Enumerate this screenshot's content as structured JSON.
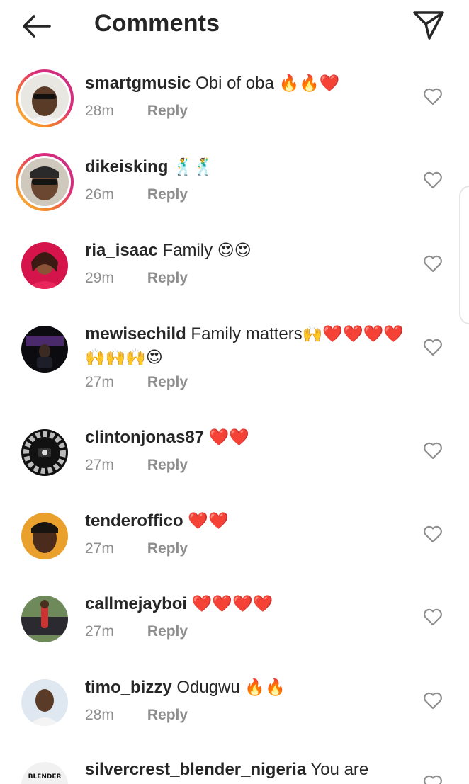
{
  "header": {
    "title": "Comments"
  },
  "actions": {
    "reply_label": "Reply"
  },
  "comments": [
    {
      "username": "smartgmusic",
      "text": "Obi of oba",
      "emoji": "🔥🔥❤️",
      "time": "28m",
      "story_ring": true
    },
    {
      "username": "dikeisking",
      "text": "",
      "emoji": "🕺🕺",
      "time": "26m",
      "story_ring": true
    },
    {
      "username": "ria_isaac",
      "text": "Family",
      "emoji": "😍😍",
      "time": "29m",
      "story_ring": false
    },
    {
      "username": "mewisechild",
      "text": "Family  matters",
      "emoji": "🙌❤️❤️❤️❤️🙌🙌🙌😍",
      "time": "27m",
      "story_ring": false
    },
    {
      "username": "clintonjonas87",
      "text": "",
      "emoji": "❤️❤️",
      "time": "27m",
      "story_ring": false
    },
    {
      "username": "tenderoffico",
      "text": "",
      "emoji": "❤️❤️",
      "time": "27m",
      "story_ring": false
    },
    {
      "username": "callmejayboi",
      "text": "",
      "emoji": "❤️❤️❤️❤️",
      "time": "27m",
      "story_ring": false
    },
    {
      "username": "timo_bizzy",
      "text": "Odugwu",
      "emoji": "🔥🔥",
      "time": "28m",
      "story_ring": false
    },
    {
      "username": "silvercrest_blender_nigeria",
      "text": "You are",
      "emoji": "",
      "time": "",
      "story_ring": false,
      "avatar_text": "BLENDER"
    }
  ],
  "colors": {
    "text": "#262626",
    "meta": "#8e8e8e",
    "story_ring_start": "#f6c243",
    "story_ring_end": "#c13584"
  },
  "icons": {
    "back": "arrow-left-icon",
    "send": "paper-plane-icon",
    "like": "heart-outline-icon"
  }
}
